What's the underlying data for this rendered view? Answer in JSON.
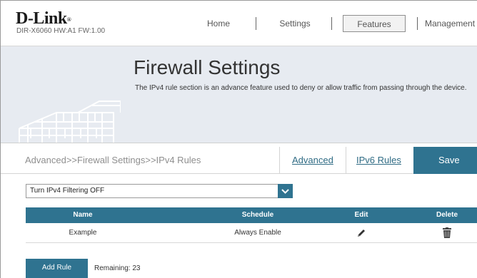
{
  "header": {
    "logo": "D-Link",
    "logo_mark": "®",
    "model": "DIR-X6060 HW:A1 FW:1.00",
    "nav": [
      {
        "label": "Home"
      },
      {
        "label": "Settings"
      },
      {
        "label": "Features"
      },
      {
        "label": "Management"
      }
    ],
    "active_nav": "Features"
  },
  "banner": {
    "title": "Firewall Settings",
    "description": "The IPv4 rule section is an advance feature used to deny or allow traffic from passing through the device."
  },
  "breadcrumb": {
    "path": "Advanced>>Firewall Settings>>IPv4 Rules",
    "links": {
      "advanced": "Advanced",
      "ipv6": "IPv6 Rules"
    },
    "save_label": "Save"
  },
  "filter_select": {
    "value": "Turn IPv4 Filtering OFF"
  },
  "table": {
    "columns": {
      "name": "Name",
      "schedule": "Schedule",
      "edit": "Edit",
      "delete": "Delete"
    },
    "rows": [
      {
        "name": "Example",
        "schedule": "Always Enable",
        "edit_icon": "pencil-icon",
        "delete_icon": "trash-icon"
      }
    ]
  },
  "footer": {
    "add_label": "Add Rule",
    "remaining": "Remaining: 23"
  },
  "colors": {
    "accent": "#2f7390",
    "banner_bg": "#e7ebf1",
    "link": "#2f6b84"
  }
}
